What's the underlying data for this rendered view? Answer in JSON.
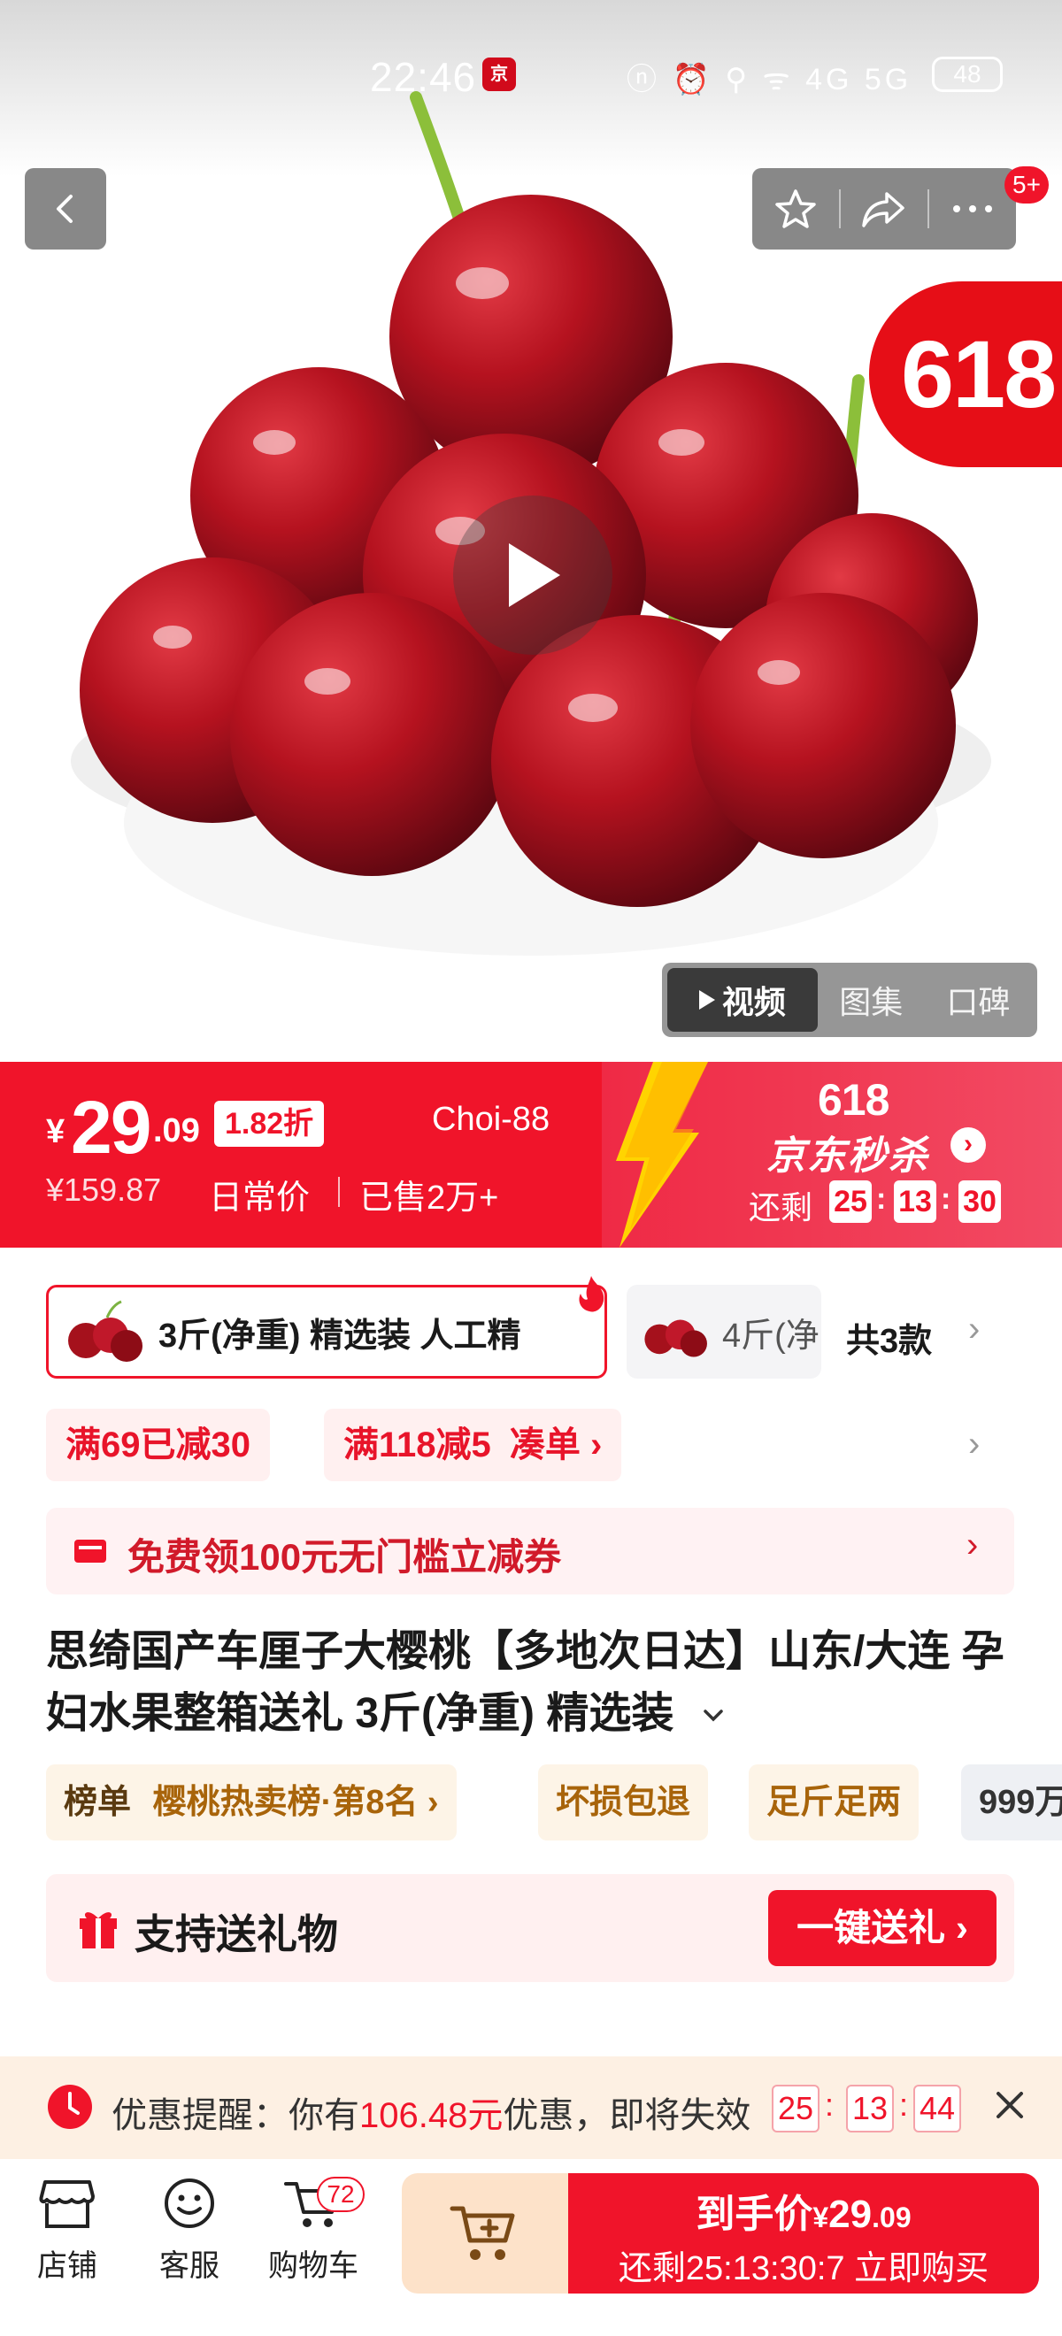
{
  "status_bar": {
    "time": "22:46",
    "app_badge": "京",
    "icons": "ⓝ ⏰ ⚲ ᯤ 4G 5G",
    "battery": "48"
  },
  "header": {
    "notification_count": "5+"
  },
  "hero": {
    "promo_badge": "618"
  },
  "media_tabs": [
    {
      "label": "视频",
      "active": true
    },
    {
      "label": "图集",
      "active": false
    },
    {
      "label": "口碑",
      "active": false
    }
  ],
  "price": {
    "currency": "¥",
    "integer": "29",
    "decimal": ".09",
    "discount": "1.82折",
    "coupon_code": "Choi-88",
    "original_price": "¥159.87",
    "original_label": "日常价",
    "sold": "已售2万+"
  },
  "seckill": {
    "event": "618",
    "name": "京东秒杀",
    "remain_label": "还剩",
    "hours": "25",
    "minutes": "13",
    "seconds": "30"
  },
  "sku": {
    "selected": "3斤(净重) 精选装 人工精",
    "other": "4斤(净",
    "total": "共3款"
  },
  "promos": [
    {
      "label": "满69已减30"
    },
    {
      "label": "满118减5",
      "action": "凑单 ›"
    }
  ],
  "coupon": {
    "text": "免费领100元无门槛立减券"
  },
  "product": {
    "title": "思绮国产车厘子大樱桃【多地次日达】山东/大连 孕妇水果整箱送礼 3斤(净重) 精选装"
  },
  "badges": {
    "rank_prefix": "榜单",
    "rank_text": "樱桃热卖榜·第8名 ›",
    "damage": "坏损包退",
    "weight": "足斤足两",
    "more": "999万"
  },
  "gift": {
    "label": "支持送礼物",
    "button": "一键送礼 ›"
  },
  "reminder": {
    "prefix": "优惠提醒：你有",
    "amount": "106.48元",
    "suffix": "优惠，即将失效",
    "hours": "25",
    "minutes": "13",
    "seconds": "44"
  },
  "bottom_nav": {
    "store": "店铺",
    "service": "客服",
    "cart": "购物车",
    "cart_count": "72"
  },
  "buy": {
    "label": "到手价",
    "currency": "¥",
    "integer": "29",
    "decimal": ".09",
    "countdown": "还剩25:13:30:7 立即购买"
  },
  "colors": {
    "brand_red": "#f0142a",
    "gift_orange": "#fde2c9",
    "badge_gold": "#a8640a"
  }
}
